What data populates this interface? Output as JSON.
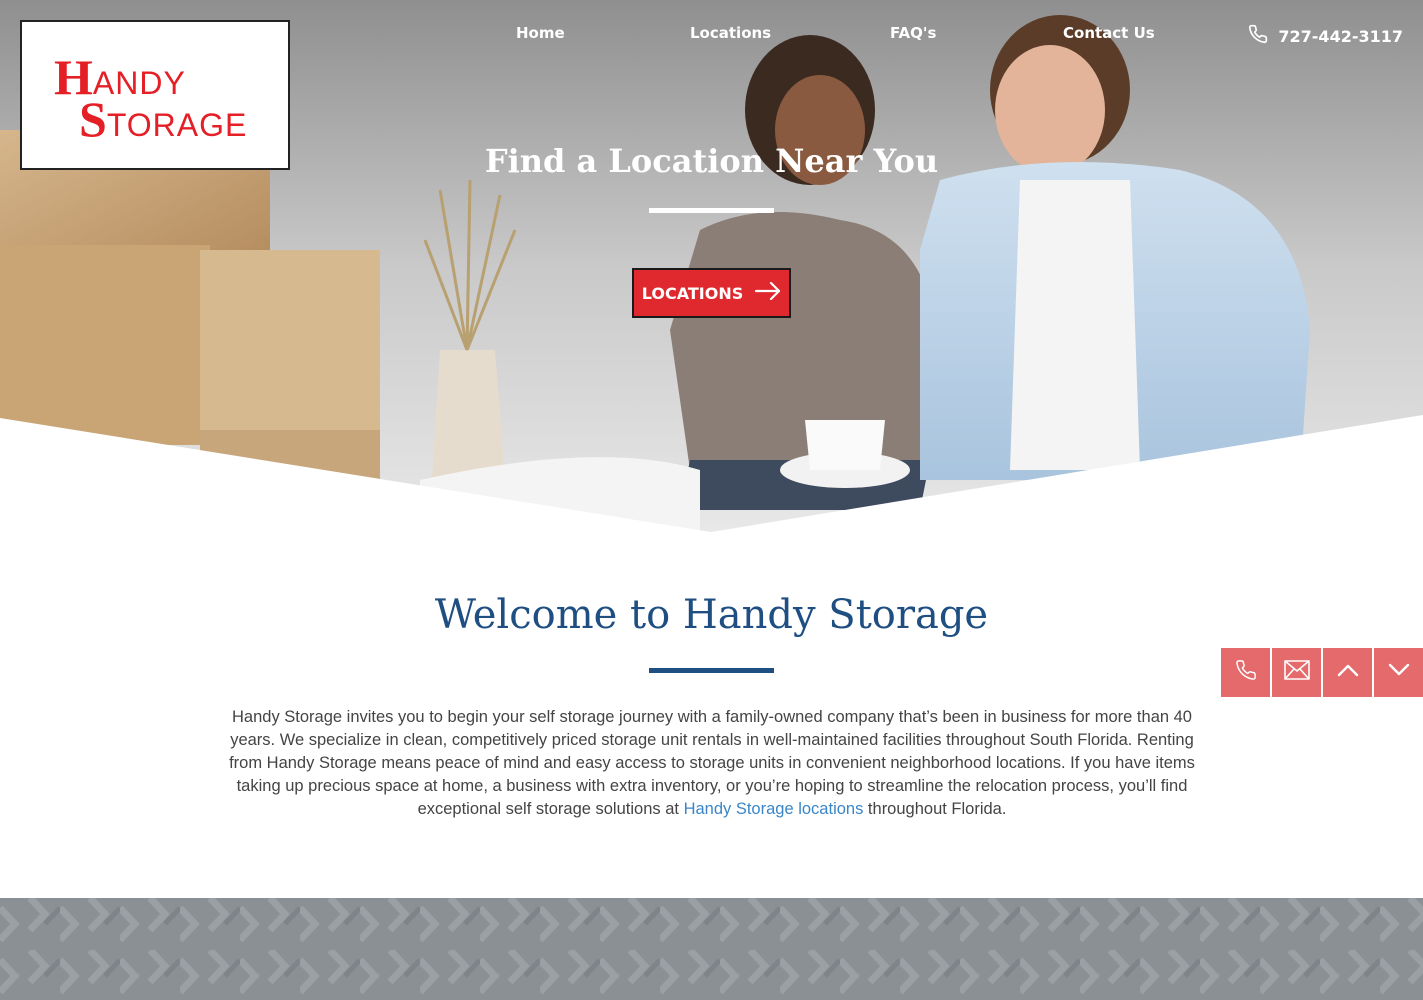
{
  "logo": {
    "line1_initial": "H",
    "line1_rest": "ANDY",
    "line2_initial": "S",
    "line2_rest": "TORAGE",
    "brand_color": "#e41f26"
  },
  "nav": {
    "items": [
      {
        "label": "Home"
      },
      {
        "label": "Locations"
      },
      {
        "label": "FAQ's"
      },
      {
        "label": "Contact Us"
      }
    ],
    "phone": "727-442-3117",
    "phone_icon": "phone-icon"
  },
  "hero": {
    "title": "Find a Location Near You",
    "button_label": "LOCATIONS",
    "button_icon": "arrow-right-icon",
    "button_color": "#e0292e"
  },
  "welcome": {
    "title": "Welcome to Handy Storage",
    "body_before_link": "Handy Storage invites you to begin your self storage journey with a family-owned company that’s been in business for more than 40 years. We specialize in clean, competitively priced storage unit rentals in well-maintained facilities throughout South Florida. Renting from Handy Storage means peace of mind and easy access to storage units in convenient neighborhood locations. If you have items taking up precious space at home, a business with extra inventory, or you’re hoping to streamline the relocation process, you’ll find exceptional self storage solutions at ",
    "link_text": "Handy Storage locations",
    "body_after_link": " throughout Florida.",
    "title_color": "#1f4f82",
    "link_color": "#3a86c9"
  },
  "side_actions": {
    "icons": [
      "phone-icon",
      "mail-icon",
      "chevron-up-icon",
      "chevron-down-icon"
    ],
    "color": "#e46a6c"
  },
  "footer": {
    "band_color": "#8b9095"
  }
}
